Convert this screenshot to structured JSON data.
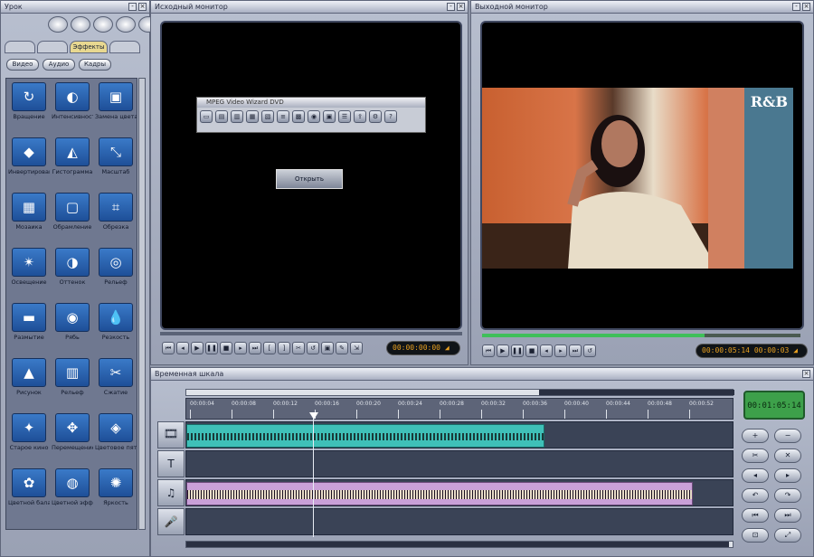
{
  "effects_window": {
    "title": "Урок",
    "tabs": [
      "",
      "",
      "Эффекты",
      ""
    ],
    "subtabs": [
      "Видео",
      "Аудио",
      "Кадры"
    ]
  },
  "effects": [
    {
      "label": "Вращение",
      "icon": "↻"
    },
    {
      "label": "Интенсивность",
      "icon": "◐"
    },
    {
      "label": "Замена цвета",
      "icon": "▣"
    },
    {
      "label": "Инвертирование",
      "icon": "◆"
    },
    {
      "label": "Гистограмма",
      "icon": "◭"
    },
    {
      "label": "Масштаб",
      "icon": "⤡"
    },
    {
      "label": "Мозаика",
      "icon": "▦"
    },
    {
      "label": "Обрамление",
      "icon": "▢"
    },
    {
      "label": "Обрезка",
      "icon": "⌗"
    },
    {
      "label": "Освещение",
      "icon": "✴"
    },
    {
      "label": "Оттенок",
      "icon": "◑"
    },
    {
      "label": "Рельеф",
      "icon": "◎"
    },
    {
      "label": "Размытие",
      "icon": "▬"
    },
    {
      "label": "Рябь",
      "icon": "◉"
    },
    {
      "label": "Резкость",
      "icon": "💧"
    },
    {
      "label": "Рисунок",
      "icon": "▲"
    },
    {
      "label": "Рельеф",
      "icon": "▥"
    },
    {
      "label": "Сжатие",
      "icon": "✂"
    },
    {
      "label": "Старое кино",
      "icon": "✦"
    },
    {
      "label": "Перемещение",
      "icon": "✥"
    },
    {
      "label": "Цветовое пятно",
      "icon": "◈"
    },
    {
      "label": "Цветной баланс",
      "icon": "✿"
    },
    {
      "label": "Цветной эффект",
      "icon": "◍"
    },
    {
      "label": "Яркость",
      "icon": "✺"
    }
  ],
  "source_monitor": {
    "title": "Исходный монитор",
    "inner_window_title": "MPEG Video Wizard DVD",
    "inner_button": "Открыть",
    "timecode": "00:00:00:00"
  },
  "output_monitor": {
    "title": "Выходной монитор",
    "timecode": "00:00:05:14",
    "timecode2": "00:00:03",
    "logo": "R&B"
  },
  "timeline": {
    "title": "Временная шкала",
    "clock": "00:01:05:14",
    "ticks": [
      "00:00:04",
      "00:00:08",
      "00:00:12",
      "00:00:16",
      "00:00:20",
      "00:00:24",
      "00:00:28",
      "00:00:32",
      "00:00:36",
      "00:00:40",
      "00:00:44",
      "00:00:48",
      "00:00:52"
    ]
  },
  "colors": {
    "accent": "#2f6fc0",
    "clip_video": "#3fc0b8",
    "clip_audio": "#c9a0d8",
    "timecode_text": "#e8a020",
    "clock_bg": "#3da04a"
  }
}
